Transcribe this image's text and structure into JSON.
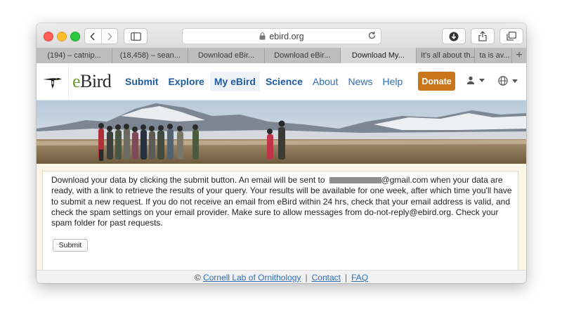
{
  "browser": {
    "url": "ebird.org",
    "tabs": [
      {
        "label": "(194) – catnip...",
        "active": false
      },
      {
        "label": "(18,458) – sean...",
        "active": false
      },
      {
        "label": "Download eBir...",
        "active": false
      },
      {
        "label": "Download eBir...",
        "active": false
      },
      {
        "label": "Download My...",
        "active": true
      },
      {
        "label": "It's all about th...",
        "active": false
      },
      {
        "label": "ta is av...",
        "active": false
      }
    ],
    "new_tab_label": "+"
  },
  "header": {
    "logo_prefix": "e",
    "logo_suffix": "Bird",
    "nav": [
      {
        "label": "Submit",
        "style": "bold"
      },
      {
        "label": "Explore",
        "style": "bold"
      },
      {
        "label": "My eBird",
        "style": "bold-active"
      },
      {
        "label": "Science",
        "style": "bold"
      },
      {
        "label": "About",
        "style": "normal"
      },
      {
        "label": "News",
        "style": "normal"
      },
      {
        "label": "Help",
        "style": "normal"
      }
    ],
    "donate_label": "Donate",
    "donate_color": "#c9761b"
  },
  "content": {
    "message_before_email": "Download your data by clicking the submit button. An email will be sent to",
    "message_email_suffix": "@gmail.com",
    "message_after_email": " when your data are ready, with a link to retrieve the results of your query. Your results will be available for one week, after which time you'll have to submit a new request. If you do not receive an email from eBird within 24 hrs, check that your email address is valid, and check the spam settings on your email provider. Make sure to allow messages from do-not-reply@ebird.org. Check your spam folder for past requests.",
    "submit_label": "Submit"
  },
  "footer": {
    "copyright": "©",
    "links": [
      "Cornell Lab of Ornithology",
      "Contact",
      "FAQ"
    ],
    "separator": "|"
  },
  "colors": {
    "link": "#2f6fb5",
    "content_bg": "#fbf6e8"
  }
}
